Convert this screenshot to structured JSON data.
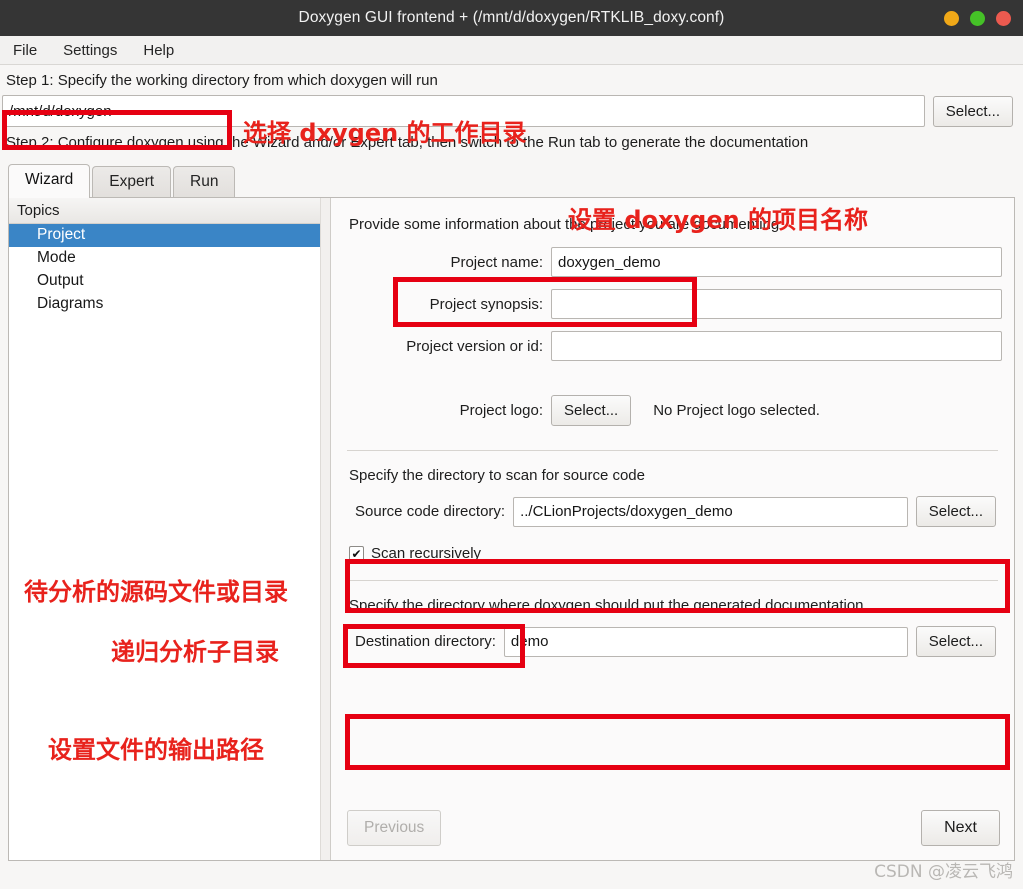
{
  "window": {
    "title": "Doxygen GUI frontend + (/mnt/d/doxygen/RTKLIB_doxy.conf)",
    "buttons": [
      {
        "name": "minimize",
        "color": "#f0a818"
      },
      {
        "name": "maximize",
        "color": "#45c127"
      },
      {
        "name": "close",
        "color": "#ec5a4f"
      }
    ]
  },
  "menubar": {
    "items": [
      {
        "label": "File"
      },
      {
        "label": "Settings"
      },
      {
        "label": "Help"
      }
    ]
  },
  "step1": {
    "label": "Step 1: Specify the working directory from which doxygen will run",
    "working_directory": "/mnt/d/doxygen",
    "placeholder": "",
    "select_label": "Select..."
  },
  "step2": {
    "label": "Step 2: Configure doxygen using the Wizard and/or Expert tab, then switch to the Run tab to generate the documentation"
  },
  "tabs": [
    {
      "label": "Wizard",
      "active": true
    },
    {
      "label": "Expert",
      "active": false
    },
    {
      "label": "Run",
      "active": false
    }
  ],
  "topics": {
    "header": "Topics",
    "items": [
      {
        "label": "Project",
        "selected": true
      },
      {
        "label": "Mode",
        "selected": false
      },
      {
        "label": "Output",
        "selected": false
      },
      {
        "label": "Diagrams",
        "selected": false
      }
    ]
  },
  "wizard": {
    "project_section_text": "Provide some information about the project you are documenting",
    "project_name_label": "Project name:",
    "project_name_value": "doxygen_demo",
    "project_synopsis_label": "Project synopsis:",
    "project_synopsis_value": "",
    "project_version_label": "Project version or id:",
    "project_version_value": "",
    "project_logo_label": "Project logo:",
    "project_logo_select": "Select...",
    "project_logo_status": "No Project logo selected.",
    "source_section_text": "Specify the directory to scan for source code",
    "source_dir_label": "Source code directory:",
    "source_dir_value": "../CLionProjects/doxygen_demo",
    "source_dir_select": "Select...",
    "scan_recursively_label": "Scan recursively",
    "scan_recursively_checked": true,
    "scan_recursively_glyph": "✔",
    "destination_section_text": "Specify the directory where doxygen should put the generated documentation",
    "destination_dir_label": "Destination directory:",
    "destination_dir_value": "demo",
    "destination_dir_select": "Select...",
    "previous_label": "Previous",
    "next_label": "Next"
  },
  "annotations": {
    "workdir_note": "选择 dxygen 的工作目录",
    "project_name_note": "设置 doxygen 的项目名称",
    "source_note": "待分析的源码文件或目录",
    "recursive_note": "递归分析子目录",
    "destination_note": "设置文件的输出路径",
    "highlight_color": "#e60012"
  },
  "watermark": "CSDN @凌云飞鸿"
}
